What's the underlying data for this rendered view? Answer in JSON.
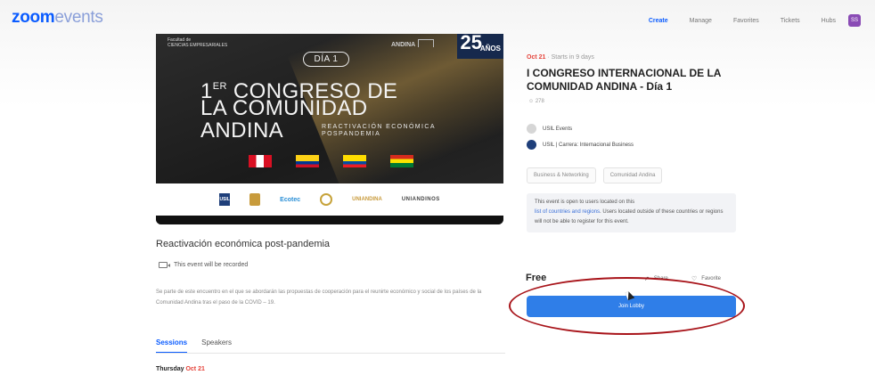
{
  "header": {
    "logo_bold": "zoom",
    "logo_light": "events",
    "nav": [
      "Create",
      "Manage",
      "Favorites",
      "Tickets",
      "Hubs"
    ],
    "avatar": "SS"
  },
  "banner": {
    "faculty": "Facultad de\nCIENCIAS EMPRESARIALES",
    "andina_logo": "ANDINA",
    "anniversary_number": "25",
    "anniversary_text": "AÑOS",
    "day_pill": "DÍA 1",
    "line1_prefix": "1",
    "line1_sup": "ER",
    "line1_rest": "CONGRESO DE",
    "line2": "LA COMUNIDAD",
    "line3": "ANDINA",
    "subline1": "REACTIVACIÓN ECONÓMICA",
    "subline2": "POSPANDEMIA",
    "sponsors": [
      "USIL",
      "Ecotec",
      "UNIANDINA",
      "UNIANDINOS"
    ]
  },
  "event": {
    "subtitle": "Reactivación económica post-pandemia",
    "recorded": "This event will be recorded",
    "description": "Se parte de este encuentro en el que se abordarán las propuestas de cooperación para el reunirte económico y social de los países de la Comunidad Andina tras el paso de la COVID – 19.",
    "tabs": [
      "Sessions",
      "Speakers"
    ],
    "day_label": "Thursday",
    "day_month": "Oct 21"
  },
  "panel": {
    "date": "Oct 21",
    "starts_in": "Starts in 9 days",
    "title": "I CONGRESO INTERNACIONAL DE LA COMUNIDAD ANDINA - Día 1",
    "attendees": "278",
    "organizer1": "USIL Events",
    "organizer2": "USIL | Carrera: Internacional Business",
    "tags": [
      "Business & Networking",
      "Comunidad Andina"
    ],
    "notice_pre": "This event is open to users located on this",
    "notice_link": "list of countries and regions",
    "notice_post": ". Users located outside of these countries or regions will not be able to register for this event.",
    "price": "Free",
    "share": "Share",
    "favorite": "Favorite",
    "join": "Join Lobby"
  },
  "colors": {
    "accent": "#0b5cff",
    "button": "#2f7ee8",
    "highlight_ring": "#a8141a"
  }
}
